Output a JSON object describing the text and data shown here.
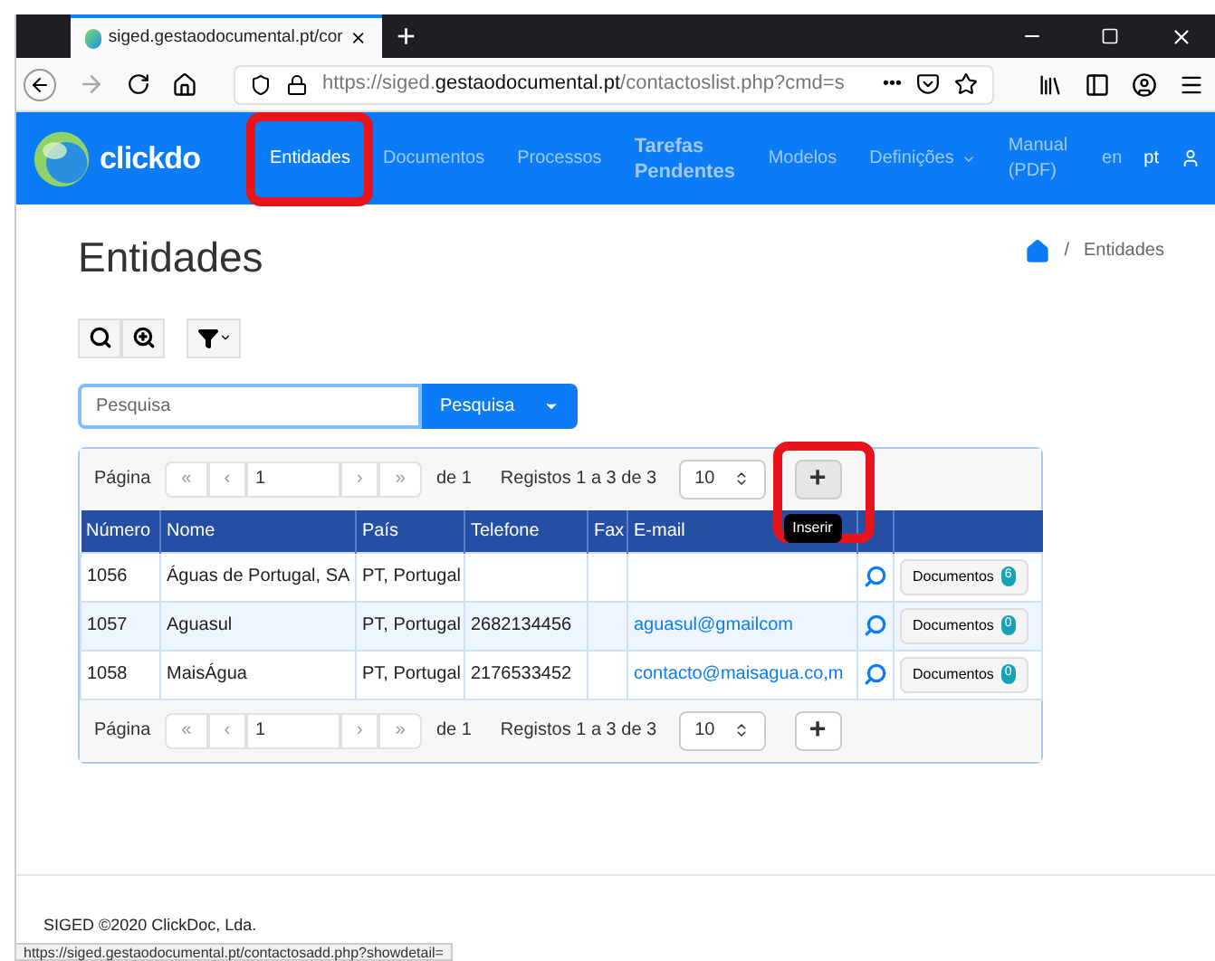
{
  "browser": {
    "tab_title": "siged.gestaodocumental.pt/cor",
    "new_tab": "+",
    "url_host_prefix": "https://siged.",
    "url_host": "gestaodocumental.pt",
    "url_path": "/contactoslist.php?cmd=s",
    "more": "•••"
  },
  "navbar": {
    "logo": "clickdo",
    "items": [
      {
        "label": "Entidades",
        "selected": true,
        "highlighted": true,
        "bold": false,
        "dropdown": false
      },
      {
        "label": "Documentos",
        "selected": false,
        "highlighted": false,
        "bold": false,
        "dropdown": false
      },
      {
        "label": "Processos",
        "selected": false,
        "highlighted": false,
        "bold": false,
        "dropdown": false
      },
      {
        "label": "Tarefas Pendentes",
        "selected": false,
        "highlighted": false,
        "bold": true,
        "dropdown": false
      },
      {
        "label": "Modelos",
        "selected": false,
        "highlighted": false,
        "bold": false,
        "dropdown": false
      },
      {
        "label": "Definições",
        "selected": false,
        "highlighted": false,
        "bold": false,
        "dropdown": true
      },
      {
        "label": "Manual (PDF)",
        "selected": false,
        "highlighted": false,
        "bold": false,
        "dropdown": false
      }
    ],
    "languages": [
      {
        "label": "en",
        "selected": false
      },
      {
        "label": "pt",
        "selected": true
      }
    ]
  },
  "page": {
    "title": "Entidades",
    "breadcrumb_separator": "/",
    "breadcrumb": "Entidades"
  },
  "search": {
    "placeholder": "Pesquisa",
    "button": "Pesquisa"
  },
  "pagers": [
    {
      "label": "Página",
      "first": "«",
      "prev": "‹",
      "page": "1",
      "next": "›",
      "last": "»",
      "of": "de 1",
      "records": "Registos 1 a 3 de 3",
      "page_size": "10",
      "insert": "+",
      "insert_highlighted": true,
      "tooltip": "Inserir"
    },
    {
      "label": "Página",
      "first": "«",
      "prev": "‹",
      "page": "1",
      "next": "›",
      "last": "»",
      "of": "de 1",
      "records": "Registos 1 a 3 de 3",
      "page_size": "10",
      "insert": "+",
      "insert_highlighted": false
    }
  ],
  "table": {
    "columns": [
      "Número",
      "Nome",
      "País",
      "Telefone",
      "Fax",
      "E-mail"
    ],
    "rows": [
      {
        "cells": [
          "1056",
          "Águas de Portugal, SA",
          "PT, Portugal",
          "",
          "",
          ""
        ],
        "button": "Documentos",
        "count": "6"
      },
      {
        "cells": [
          "1057",
          "Aguasul",
          "PT, Portugal",
          "2682134456",
          "",
          "aguasul@gmailcom"
        ],
        "button": "Documentos",
        "count": "0"
      },
      {
        "cells": [
          "1058",
          "MaisÁgua",
          "PT, Portugal",
          "2176533452",
          "",
          "contacto@maisagua.co,m"
        ],
        "button": "Documentos",
        "count": "0"
      }
    ]
  },
  "footer": {
    "text": "SIGED ©2020 ClickDoc, Lda."
  },
  "status_bar": {
    "url": "https://siged.gestaodocumental.pt/contactosadd.php?showdetail="
  }
}
